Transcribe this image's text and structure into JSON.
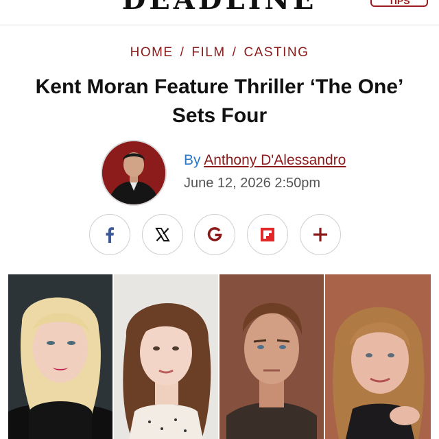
{
  "header": {
    "logo": "DEADLINE",
    "tips_label": "TIPS"
  },
  "breadcrumb": [
    "HOME",
    "FILM",
    "CASTING"
  ],
  "article": {
    "title": "Kent Moran Feature Thriller ‘The One’ Sets Four",
    "byline_prefix": "By",
    "author": "Anthony D'Alessandro",
    "date": "June 12, 2026 2:50pm"
  },
  "share_buttons": [
    {
      "icon": "facebook-icon",
      "color": "#3b5998"
    },
    {
      "icon": "x-icon",
      "color": "#111111"
    },
    {
      "icon": "google-icon",
      "color": "#8b1a1a"
    },
    {
      "icon": "flipboard-icon",
      "color": "#e12828"
    },
    {
      "icon": "plus-icon",
      "color": "#8b1a1a"
    }
  ],
  "colors": {
    "accent": "#8b1a1a",
    "link_blue": "#2a78c8"
  }
}
